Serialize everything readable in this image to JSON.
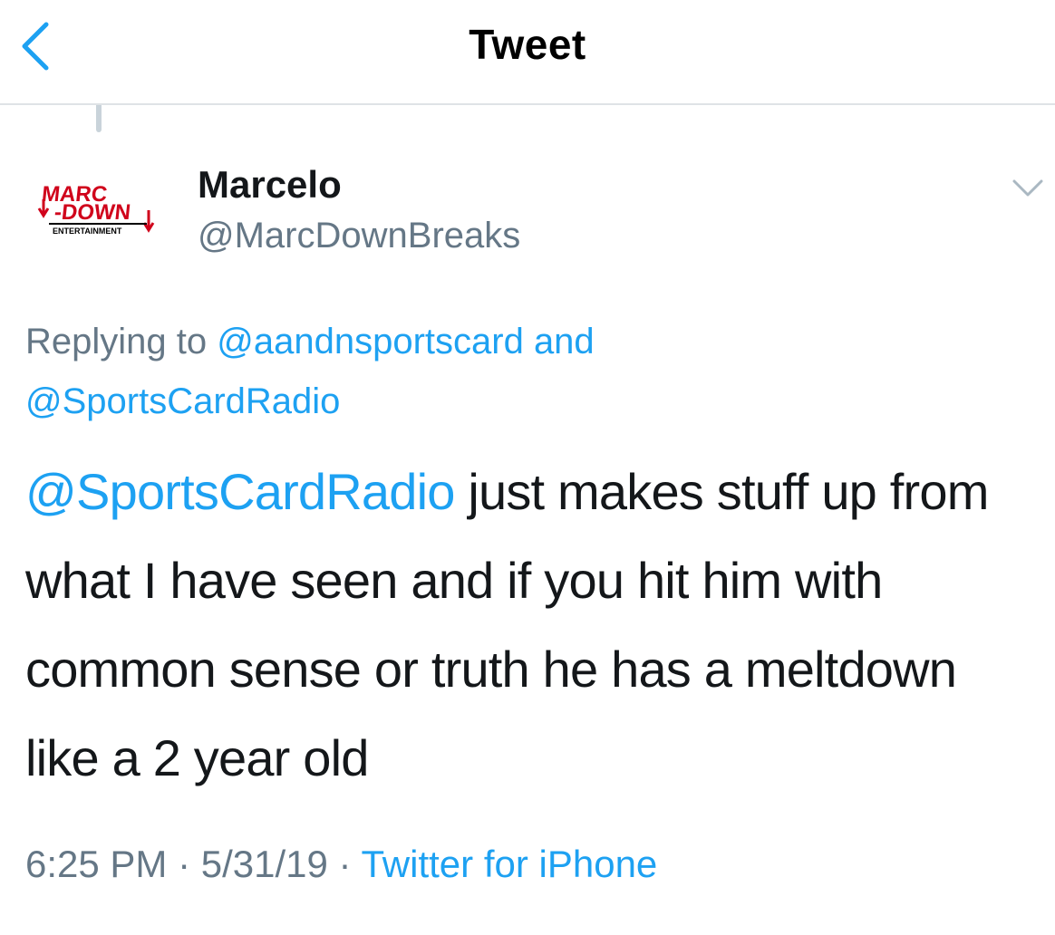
{
  "nav": {
    "title": "Tweet",
    "back_icon": "chevron-left-icon",
    "accent_color": "#1da1f2"
  },
  "author": {
    "avatar_icon": "marc-down-entertainment-logo",
    "avatar_text_line1": "MARC",
    "avatar_text_line2": "-DOWN",
    "avatar_text_line3": "ENTERTAINMENT",
    "display_name": "Marcelo",
    "handle": "@MarcDownBreaks",
    "options_icon": "chevron-down-icon"
  },
  "reply": {
    "prefix": "Replying to ",
    "mention1": "@aandnsportscard",
    "conjunction": "and",
    "mention2": "@SportsCardRadio"
  },
  "tweet": {
    "mention": "@SportsCardRadio",
    "body": " just makes stuff up from what I have seen and if you hit him with common sense or truth he has a meltdown like a 2 year old"
  },
  "meta": {
    "time": "6:25 PM",
    "separator": " · ",
    "date": "5/31/19",
    "source": "Twitter for iPhone"
  },
  "colors": {
    "text": "#14171a",
    "secondary": "#657786",
    "link": "#1da1f2",
    "divider": "#dfe3e6",
    "logo_red": "#d0021b"
  }
}
